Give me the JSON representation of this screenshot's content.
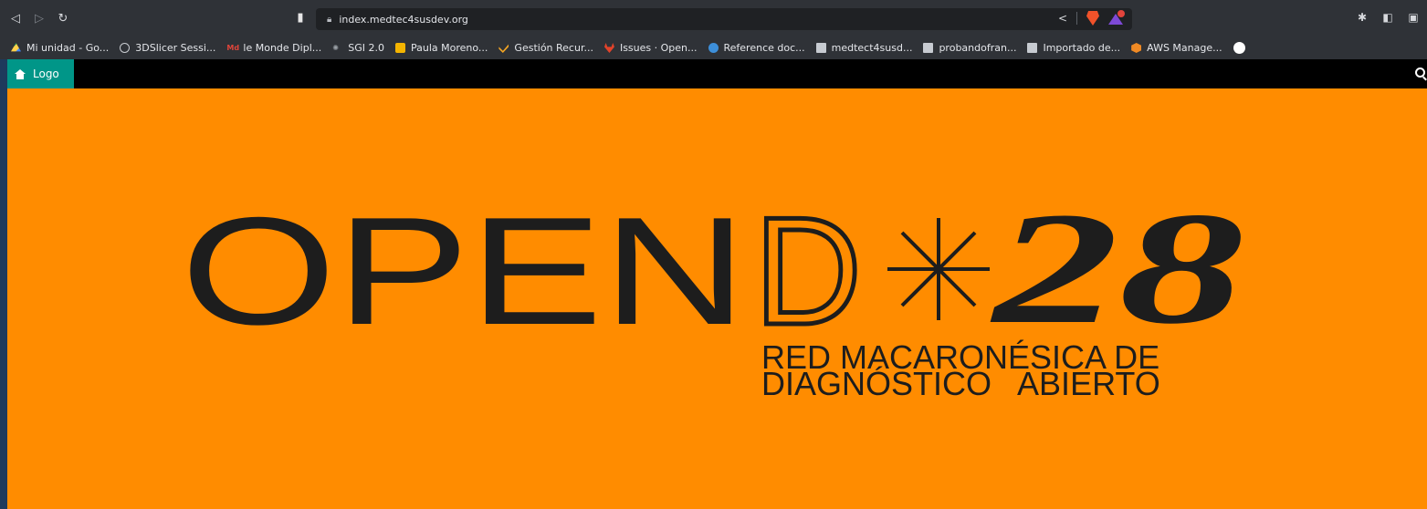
{
  "browser": {
    "url": "index.medtec4susdev.org",
    "bookmarks": [
      {
        "label": "Mi unidad - Go...",
        "icon": "google-drive-icon"
      },
      {
        "label": "3DSlicer Sessi...",
        "icon": "globe-icon"
      },
      {
        "label": "le Monde Dipl...",
        "icon": "monde-diplomatique-icon"
      },
      {
        "label": "SGI 2.0",
        "icon": "sgi-icon"
      },
      {
        "label": "Paula Moreno...",
        "icon": "paula-icon"
      },
      {
        "label": "Gestión Recur...",
        "icon": "check-icon"
      },
      {
        "label": "Issues · Open...",
        "icon": "gitlab-icon"
      },
      {
        "label": "Reference doc...",
        "icon": "reference-icon"
      },
      {
        "label": "medtect4susd...",
        "icon": "folder-icon"
      },
      {
        "label": "probandofran...",
        "icon": "folder-icon"
      },
      {
        "label": "Importado de...",
        "icon": "folder-icon"
      },
      {
        "label": "AWS Manage...",
        "icon": "aws-icon"
      }
    ]
  },
  "navbar": {
    "logo_label": "Logo"
  },
  "hero": {
    "brand_word": "OPEN",
    "brand_letter": "D",
    "brand_star": "*",
    "brand_number": "28",
    "subtitle_line1": "RED MACARONÉSICA DE",
    "subtitle_line2": "DIAGNÓSTICO   ABIERTO"
  },
  "colors": {
    "page_background": "#ff8c00",
    "navbar": "#000000",
    "logo_button": "#009688",
    "brand_text": "#1d1d1d"
  }
}
